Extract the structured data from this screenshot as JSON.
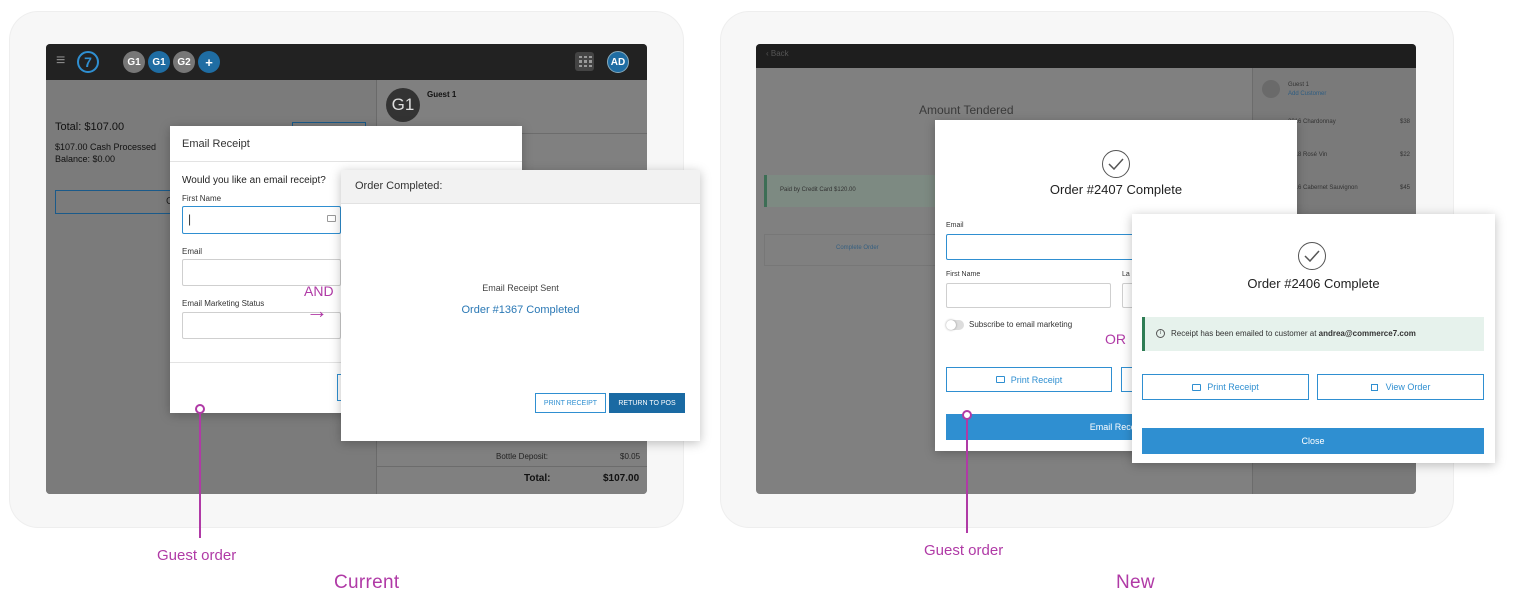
{
  "current": {
    "caption": "Current",
    "annotation_label": "Guest order",
    "and_label": "AND",
    "arrow_glyph": "→",
    "topbar": {
      "menu_icon": "≡",
      "logo": "7",
      "guest_tabs": [
        "G1",
        "G1",
        "G2",
        "+"
      ],
      "user_initials": "AD"
    },
    "left_pane": {
      "total": "Total: $107.00",
      "processed": "$107.00 Cash Processed",
      "balance": "Balance: $0.00",
      "partial_letter": "C"
    },
    "guest_panel": {
      "avatar": "G1",
      "name": "Guest 1",
      "bottle_deposit_label": "Bottle Deposit:",
      "bottle_deposit_value": "$0.05",
      "total_label": "Total:",
      "total_value": "$107.00"
    },
    "email_dialog": {
      "title": "Email Receipt",
      "question": "Would you like an email receipt?",
      "first_name_label": "First Name",
      "first_name_value": "|",
      "email_label": "Email",
      "marketing_label": "Email Marketing Status"
    },
    "completed_dialog": {
      "title": "Order Completed:",
      "sent_text": "Email Receipt Sent",
      "order_text": "Order #1367 Completed",
      "print_button": "PRINT RECEIPT",
      "return_button": "RETURN TO POS"
    }
  },
  "new": {
    "caption": "New",
    "annotation_label": "Guest order",
    "or_label": "OR",
    "background": {
      "back_link": "‹  Back",
      "amount_tendered": "Amount Tendered",
      "payment_row": "Paid by Credit Card  $120.00",
      "complete_order": "Complete Order",
      "guest_name": "Guest 1",
      "guest_link": "Add Customer",
      "items": [
        {
          "name": "2016 Chardonnay",
          "price": "$38"
        },
        {
          "name": "2018 Rosé Vin",
          "price": "$22"
        },
        {
          "name": "2016 Cabernet Sauvignon",
          "price": "$45"
        }
      ]
    },
    "dialog_a": {
      "title": "Order #2407 Complete",
      "email_label": "Email",
      "first_name_label": "First Name",
      "last_name_label_partial": "La",
      "subscribe_label": "Subscribe to email marketing",
      "print_button": "Print Receipt",
      "email_button": "Email Receipt A"
    },
    "dialog_b": {
      "title": "Order #2406 Complete",
      "notice_prefix": "Receipt has been emailed to customer at ",
      "notice_email": "andrea@commerce7.com",
      "print_button": "Print Receipt",
      "view_button": "View Order",
      "close_button": "Close"
    }
  },
  "colors": {
    "accent_blue": "#2f8fd1",
    "dark_blue": "#1a6aa3",
    "magenta": "#b03aa6",
    "notice_green": "#e6f2ec",
    "notice_bar": "#2f7d55"
  }
}
